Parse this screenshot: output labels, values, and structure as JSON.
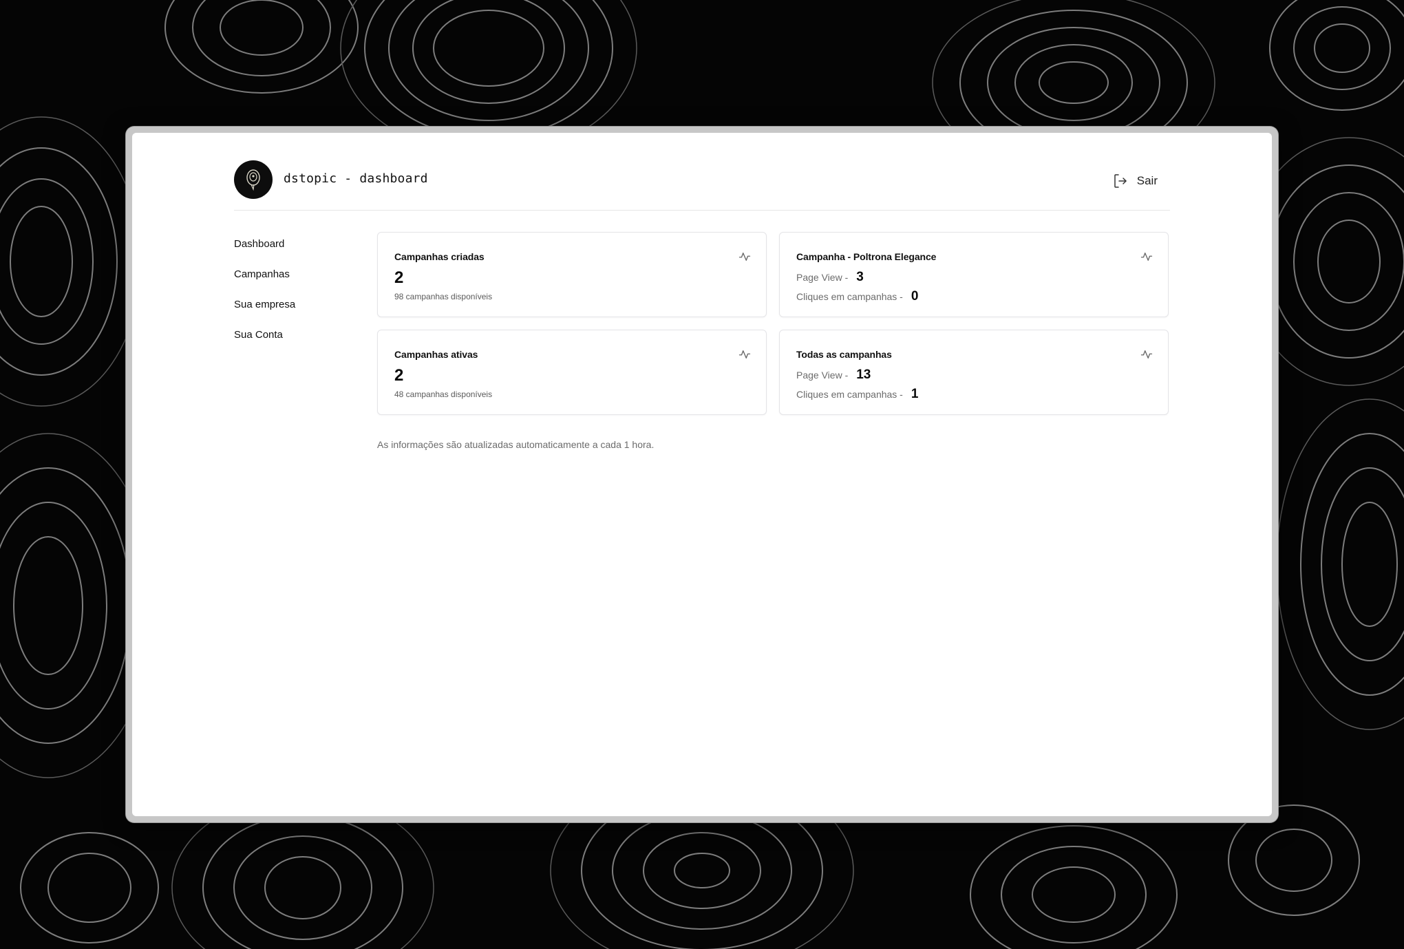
{
  "header": {
    "app_title": "dstopic - dashboard",
    "logout_label": "Sair"
  },
  "sidebar": {
    "items": [
      {
        "label": "Dashboard"
      },
      {
        "label": "Campanhas"
      },
      {
        "label": "Sua empresa"
      },
      {
        "label": "Sua Conta"
      }
    ]
  },
  "cards": {
    "created": {
      "title": "Campanhas criadas",
      "value": "2",
      "subtext": "98 campanhas disponíveis",
      "icon": "activity-icon"
    },
    "campaign": {
      "title": "Campanha - Poltrona Elegance",
      "page_view_label": "Page View -",
      "page_view_value": "3",
      "clicks_label": "Cliques em campanhas -",
      "clicks_value": "0",
      "icon": "activity-icon"
    },
    "active": {
      "title": "Campanhas ativas",
      "value": "2",
      "subtext": "48 campanhas disponíveis",
      "icon": "activity-icon"
    },
    "all": {
      "title": "Todas as campanhas",
      "page_view_label": "Page View -",
      "page_view_value": "13",
      "clicks_label": "Cliques em campanhas -",
      "clicks_value": "1",
      "icon": "activity-icon"
    }
  },
  "footnote": "As informações são atualizadas automaticamente a cada 1 hora.",
  "colors": {
    "background": "#050505",
    "surface": "#ffffff",
    "border": "#e4e4e7",
    "text": "#111111",
    "muted": "#6b6b6b"
  }
}
